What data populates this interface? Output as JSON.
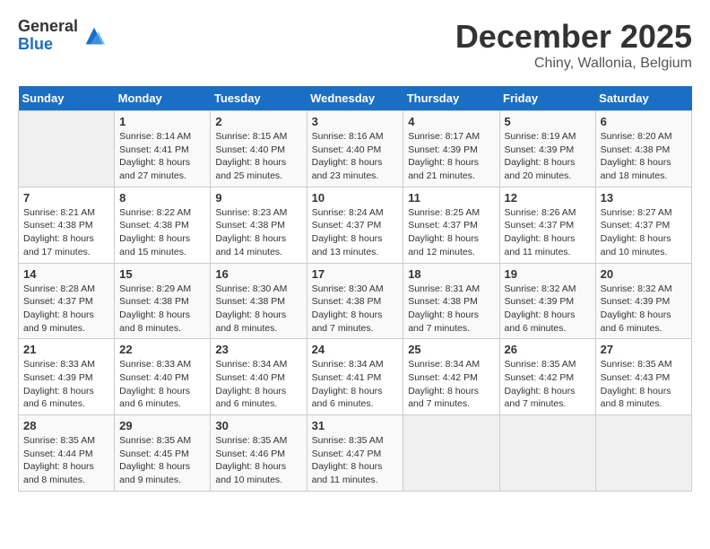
{
  "logo": {
    "general": "General",
    "blue": "Blue"
  },
  "title": "December 2025",
  "subtitle": "Chiny, Wallonia, Belgium",
  "headers": [
    "Sunday",
    "Monday",
    "Tuesday",
    "Wednesday",
    "Thursday",
    "Friday",
    "Saturday"
  ],
  "weeks": [
    [
      {
        "day": "",
        "sunrise": "",
        "sunset": "",
        "daylight": ""
      },
      {
        "day": "1",
        "sunrise": "Sunrise: 8:14 AM",
        "sunset": "Sunset: 4:41 PM",
        "daylight": "Daylight: 8 hours and 27 minutes."
      },
      {
        "day": "2",
        "sunrise": "Sunrise: 8:15 AM",
        "sunset": "Sunset: 4:40 PM",
        "daylight": "Daylight: 8 hours and 25 minutes."
      },
      {
        "day": "3",
        "sunrise": "Sunrise: 8:16 AM",
        "sunset": "Sunset: 4:40 PM",
        "daylight": "Daylight: 8 hours and 23 minutes."
      },
      {
        "day": "4",
        "sunrise": "Sunrise: 8:17 AM",
        "sunset": "Sunset: 4:39 PM",
        "daylight": "Daylight: 8 hours and 21 minutes."
      },
      {
        "day": "5",
        "sunrise": "Sunrise: 8:19 AM",
        "sunset": "Sunset: 4:39 PM",
        "daylight": "Daylight: 8 hours and 20 minutes."
      },
      {
        "day": "6",
        "sunrise": "Sunrise: 8:20 AM",
        "sunset": "Sunset: 4:38 PM",
        "daylight": "Daylight: 8 hours and 18 minutes."
      }
    ],
    [
      {
        "day": "7",
        "sunrise": "Sunrise: 8:21 AM",
        "sunset": "Sunset: 4:38 PM",
        "daylight": "Daylight: 8 hours and 17 minutes."
      },
      {
        "day": "8",
        "sunrise": "Sunrise: 8:22 AM",
        "sunset": "Sunset: 4:38 PM",
        "daylight": "Daylight: 8 hours and 15 minutes."
      },
      {
        "day": "9",
        "sunrise": "Sunrise: 8:23 AM",
        "sunset": "Sunset: 4:38 PM",
        "daylight": "Daylight: 8 hours and 14 minutes."
      },
      {
        "day": "10",
        "sunrise": "Sunrise: 8:24 AM",
        "sunset": "Sunset: 4:37 PM",
        "daylight": "Daylight: 8 hours and 13 minutes."
      },
      {
        "day": "11",
        "sunrise": "Sunrise: 8:25 AM",
        "sunset": "Sunset: 4:37 PM",
        "daylight": "Daylight: 8 hours and 12 minutes."
      },
      {
        "day": "12",
        "sunrise": "Sunrise: 8:26 AM",
        "sunset": "Sunset: 4:37 PM",
        "daylight": "Daylight: 8 hours and 11 minutes."
      },
      {
        "day": "13",
        "sunrise": "Sunrise: 8:27 AM",
        "sunset": "Sunset: 4:37 PM",
        "daylight": "Daylight: 8 hours and 10 minutes."
      }
    ],
    [
      {
        "day": "14",
        "sunrise": "Sunrise: 8:28 AM",
        "sunset": "Sunset: 4:37 PM",
        "daylight": "Daylight: 8 hours and 9 minutes."
      },
      {
        "day": "15",
        "sunrise": "Sunrise: 8:29 AM",
        "sunset": "Sunset: 4:38 PM",
        "daylight": "Daylight: 8 hours and 8 minutes."
      },
      {
        "day": "16",
        "sunrise": "Sunrise: 8:30 AM",
        "sunset": "Sunset: 4:38 PM",
        "daylight": "Daylight: 8 hours and 8 minutes."
      },
      {
        "day": "17",
        "sunrise": "Sunrise: 8:30 AM",
        "sunset": "Sunset: 4:38 PM",
        "daylight": "Daylight: 8 hours and 7 minutes."
      },
      {
        "day": "18",
        "sunrise": "Sunrise: 8:31 AM",
        "sunset": "Sunset: 4:38 PM",
        "daylight": "Daylight: 8 hours and 7 minutes."
      },
      {
        "day": "19",
        "sunrise": "Sunrise: 8:32 AM",
        "sunset": "Sunset: 4:39 PM",
        "daylight": "Daylight: 8 hours and 6 minutes."
      },
      {
        "day": "20",
        "sunrise": "Sunrise: 8:32 AM",
        "sunset": "Sunset: 4:39 PM",
        "daylight": "Daylight: 8 hours and 6 minutes."
      }
    ],
    [
      {
        "day": "21",
        "sunrise": "Sunrise: 8:33 AM",
        "sunset": "Sunset: 4:39 PM",
        "daylight": "Daylight: 8 hours and 6 minutes."
      },
      {
        "day": "22",
        "sunrise": "Sunrise: 8:33 AM",
        "sunset": "Sunset: 4:40 PM",
        "daylight": "Daylight: 8 hours and 6 minutes."
      },
      {
        "day": "23",
        "sunrise": "Sunrise: 8:34 AM",
        "sunset": "Sunset: 4:40 PM",
        "daylight": "Daylight: 8 hours and 6 minutes."
      },
      {
        "day": "24",
        "sunrise": "Sunrise: 8:34 AM",
        "sunset": "Sunset: 4:41 PM",
        "daylight": "Daylight: 8 hours and 6 minutes."
      },
      {
        "day": "25",
        "sunrise": "Sunrise: 8:34 AM",
        "sunset": "Sunset: 4:42 PM",
        "daylight": "Daylight: 8 hours and 7 minutes."
      },
      {
        "day": "26",
        "sunrise": "Sunrise: 8:35 AM",
        "sunset": "Sunset: 4:42 PM",
        "daylight": "Daylight: 8 hours and 7 minutes."
      },
      {
        "day": "27",
        "sunrise": "Sunrise: 8:35 AM",
        "sunset": "Sunset: 4:43 PM",
        "daylight": "Daylight: 8 hours and 8 minutes."
      }
    ],
    [
      {
        "day": "28",
        "sunrise": "Sunrise: 8:35 AM",
        "sunset": "Sunset: 4:44 PM",
        "daylight": "Daylight: 8 hours and 8 minutes."
      },
      {
        "day": "29",
        "sunrise": "Sunrise: 8:35 AM",
        "sunset": "Sunset: 4:45 PM",
        "daylight": "Daylight: 8 hours and 9 minutes."
      },
      {
        "day": "30",
        "sunrise": "Sunrise: 8:35 AM",
        "sunset": "Sunset: 4:46 PM",
        "daylight": "Daylight: 8 hours and 10 minutes."
      },
      {
        "day": "31",
        "sunrise": "Sunrise: 8:35 AM",
        "sunset": "Sunset: 4:47 PM",
        "daylight": "Daylight: 8 hours and 11 minutes."
      },
      {
        "day": "",
        "sunrise": "",
        "sunset": "",
        "daylight": ""
      },
      {
        "day": "",
        "sunrise": "",
        "sunset": "",
        "daylight": ""
      },
      {
        "day": "",
        "sunrise": "",
        "sunset": "",
        "daylight": ""
      }
    ]
  ]
}
